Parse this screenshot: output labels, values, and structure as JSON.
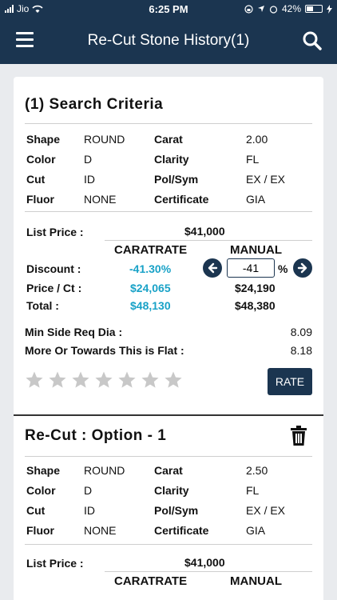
{
  "status": {
    "carrier": "Jio",
    "time": "6:25 PM",
    "battery": "42%"
  },
  "nav": {
    "title": "Re-Cut Stone History(1)"
  },
  "criteria": {
    "title": "(1) Search Criteria",
    "specs": [
      {
        "l1": "Shape",
        "v1": "ROUND",
        "l2": "Carat",
        "v2": "2.00"
      },
      {
        "l1": "Color",
        "v1": "D",
        "l2": "Clarity",
        "v2": "FL"
      },
      {
        "l1": "Cut",
        "v1": "ID",
        "l2": "Pol/Sym",
        "v2": "EX / EX"
      },
      {
        "l1": "Fluor",
        "v1": "NONE",
        "l2": "Certificate",
        "v2": "GIA"
      }
    ],
    "list_price_label": "List Price :",
    "list_price": "$41,000",
    "col_caratrate": "CARATRATE",
    "col_manual": "MANUAL",
    "discount_label": "Discount :",
    "discount_caratrate": "-41.30%",
    "discount_manual": "-41",
    "pct": "%",
    "price_ct_label": "Price / Ct :",
    "price_ct_caratrate": "$24,065",
    "price_ct_manual": "$24,190",
    "total_label": "Total :",
    "total_caratrate": "$48,130",
    "total_manual": "$48,380",
    "min_side_label": "Min Side Req Dia :",
    "min_side_value": "8.09",
    "flat_label": "More Or Towards This is Flat :",
    "flat_value": "8.18",
    "rating": 0,
    "rate_label": "RATE"
  },
  "option": {
    "title": "Re-Cut : Option - 1",
    "specs": [
      {
        "l1": "Shape",
        "v1": "ROUND",
        "l2": "Carat",
        "v2": "2.50"
      },
      {
        "l1": "Color",
        "v1": "D",
        "l2": "Clarity",
        "v2": "FL"
      },
      {
        "l1": "Cut",
        "v1": "ID",
        "l2": "Pol/Sym",
        "v2": "EX / EX"
      },
      {
        "l1": "Fluor",
        "v1": "NONE",
        "l2": "Certificate",
        "v2": "GIA"
      }
    ],
    "list_price_label": "List Price :",
    "list_price": "$41,000",
    "col_caratrate": "CARATRATE",
    "col_manual": "MANUAL"
  },
  "icons": {
    "menu": "menu-icon",
    "search": "search-icon",
    "trash": "trash-icon",
    "star": "star-icon",
    "arrow_left": "arrow-left-icon",
    "arrow_right": "arrow-right-icon"
  },
  "colors": {
    "primary": "#1b3550",
    "accent": "#19a2c7",
    "star_empty": "#c8c8c8"
  }
}
